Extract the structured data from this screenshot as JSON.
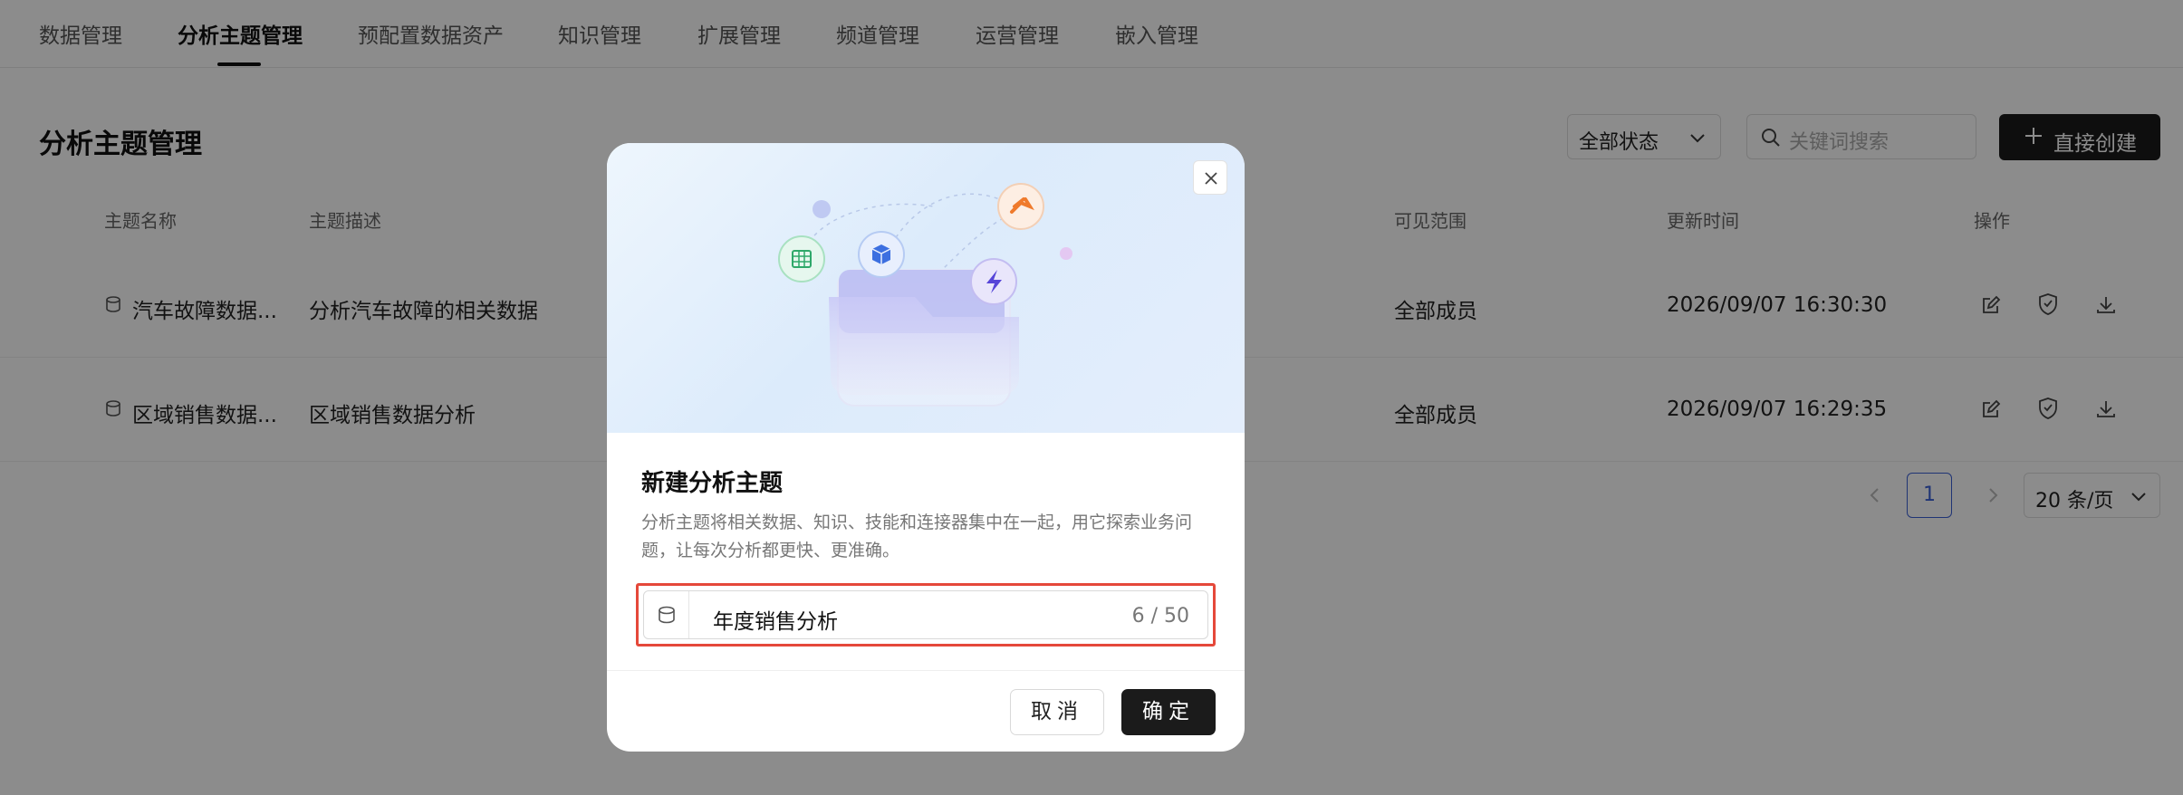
{
  "nav": {
    "tabs": [
      {
        "label": "数据管理"
      },
      {
        "label": "分析主题管理"
      },
      {
        "label": "预配置数据资产"
      },
      {
        "label": "知识管理"
      },
      {
        "label": "扩展管理"
      },
      {
        "label": "频道管理"
      },
      {
        "label": "运营管理"
      },
      {
        "label": "嵌入管理"
      }
    ]
  },
  "page": {
    "title": "分析主题管理",
    "status_filter": "全部状态",
    "search_placeholder": "关键词搜索",
    "create_label": "直接创建"
  },
  "table": {
    "headers": [
      "主题名称",
      "主题描述",
      "可见范围",
      "更新时间",
      "操作"
    ],
    "rows": [
      {
        "name": "汽车故障数据...",
        "desc": "分析汽车故障的相关数据",
        "scope": "全部成员",
        "updated": "2026/09/07 16:30:30"
      },
      {
        "name": "区域销售数据...",
        "desc": "区域销售数据分析",
        "scope": "全部成员",
        "updated": "2026/09/07 16:29:35"
      }
    ]
  },
  "pagination": {
    "current": "1",
    "page_size": "20 条/页"
  },
  "modal": {
    "title": "新建分析主题",
    "description": "分析主题将相关数据、知识、技能和连接器集中在一起，用它探索业务问题，让每次分析都更快、更准确。",
    "input_value": "年度销售分析",
    "char_count": "6 / 50",
    "cancel_label": "取消",
    "confirm_label": "确定"
  },
  "colors": {
    "accent": "#3a5fd6",
    "primary_button": "#1b1b1b",
    "highlight": "#e5483a"
  }
}
